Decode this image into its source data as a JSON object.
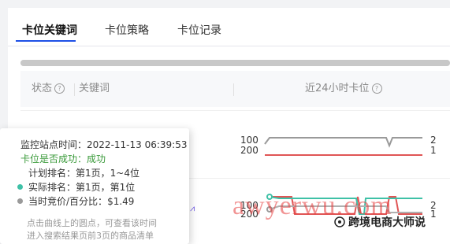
{
  "tabs": [
    {
      "label": "卡位关键词",
      "active": true
    },
    {
      "label": "卡位策略",
      "active": false
    },
    {
      "label": "卡位记录",
      "active": false
    }
  ],
  "progress": {
    "fraction": 1.0
  },
  "table": {
    "headers": {
      "status": "状态",
      "keyword": "关键词",
      "rank24h": "近24小时卡位"
    }
  },
  "rows": [
    {
      "y_top_label": "100",
      "y_bottom_label": "200",
      "right_top": "2",
      "right_bottom": "1"
    },
    {
      "y_top_label": "100",
      "y_bottom_label": "200",
      "right_top": "2",
      "right_bottom": "1"
    }
  ],
  "tooltip": {
    "time_label": "监控站点时间",
    "time_value": "2022-11-13 06:39:53",
    "success_label": "卡位是否成功",
    "success_value": "成功",
    "plan_label": "计划排名",
    "plan_value": "第1页，1~4位",
    "actual_label": "实际排名",
    "actual_value": "第1页，第1位",
    "bid_label": "当时竞价/百分比",
    "bid_value": "$1.49",
    "hint_line1": "点击曲线上的圆点，可查看该时间",
    "hint_line2": "进入搜索结果页前3页的商品清单"
  },
  "colors": {
    "accent": "#1e50e6",
    "series_gray": "#9a9a9a",
    "series_red": "#e05555",
    "series_teal": "#3fc1a7",
    "success_green": "#3a9a3a",
    "action_purple": "#6f5be6"
  },
  "watermark": {
    "text": "awyerwu.com",
    "brand": "跨境电商大师说"
  }
}
